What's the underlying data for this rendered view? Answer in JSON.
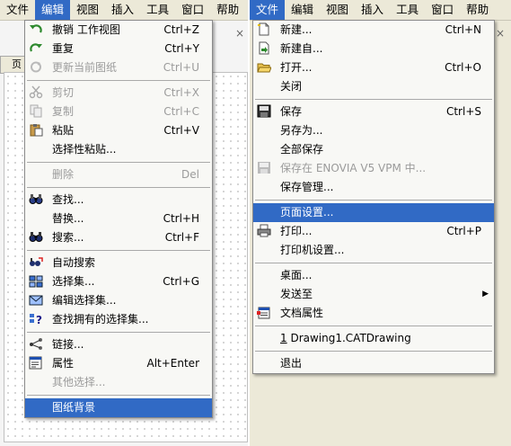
{
  "left_menubar": [
    "文件",
    "编辑",
    "视图",
    "插入",
    "工具",
    "窗口",
    "帮助"
  ],
  "right_menubar": [
    "文件",
    "编辑",
    "视图",
    "插入",
    "工具",
    "窗口",
    "帮助"
  ],
  "left_tab_label": "页",
  "close_glyph": "×",
  "edit_menu": [
    {
      "label": "撤销 工作视图",
      "shortcut": "Ctrl+Z",
      "icon": "undo-icon",
      "disabled": false
    },
    {
      "label": "重复",
      "shortcut": "Ctrl+Y",
      "icon": "redo-icon",
      "disabled": false
    },
    {
      "label": "更新当前图纸",
      "shortcut": "Ctrl+U",
      "icon": "update-icon",
      "disabled": true
    },
    {
      "sep": true
    },
    {
      "label": "剪切",
      "shortcut": "Ctrl+X",
      "icon": "cut-icon",
      "disabled": true
    },
    {
      "label": "复制",
      "shortcut": "Ctrl+C",
      "icon": "copy-icon",
      "disabled": true
    },
    {
      "label": "粘贴",
      "shortcut": "Ctrl+V",
      "icon": "paste-icon",
      "disabled": false
    },
    {
      "label": "选择性粘贴...",
      "shortcut": "",
      "icon": "",
      "disabled": false
    },
    {
      "sep": true
    },
    {
      "label": "删除",
      "shortcut": "Del",
      "icon": "",
      "disabled": true
    },
    {
      "sep": true
    },
    {
      "label": "查找...",
      "shortcut": "",
      "icon": "find-icon",
      "disabled": false
    },
    {
      "label": "替换...",
      "shortcut": "Ctrl+H",
      "icon": "",
      "disabled": false
    },
    {
      "label": "搜索...",
      "shortcut": "Ctrl+F",
      "icon": "search-icon",
      "disabled": false
    },
    {
      "sep": true
    },
    {
      "label": "自动搜索",
      "shortcut": "",
      "icon": "auto-search-icon",
      "disabled": false
    },
    {
      "label": "选择集...",
      "shortcut": "Ctrl+G",
      "icon": "selection-set-icon",
      "disabled": false
    },
    {
      "label": "编辑选择集...",
      "shortcut": "",
      "icon": "edit-selection-set-icon",
      "disabled": false
    },
    {
      "label": "查找拥有的选择集...",
      "shortcut": "",
      "icon": "find-owned-set-icon",
      "disabled": false
    },
    {
      "sep": true
    },
    {
      "label": "链接...",
      "shortcut": "",
      "icon": "links-icon",
      "disabled": false
    },
    {
      "label": "属性",
      "shortcut": "Alt+Enter",
      "icon": "properties-icon",
      "disabled": false
    },
    {
      "label": "其他选择...",
      "shortcut": "",
      "icon": "",
      "disabled": true
    },
    {
      "sep": true
    },
    {
      "label": "图纸背景",
      "shortcut": "",
      "icon": "",
      "disabled": false,
      "highlighted": true
    }
  ],
  "file_menu": [
    {
      "label": "新建...",
      "shortcut": "Ctrl+N",
      "icon": "new-file-icon",
      "disabled": false
    },
    {
      "label": "新建自...",
      "shortcut": "",
      "icon": "new-from-icon",
      "disabled": false
    },
    {
      "label": "打开...",
      "shortcut": "Ctrl+O",
      "icon": "open-folder-icon",
      "disabled": false
    },
    {
      "label": "关闭",
      "shortcut": "",
      "icon": "",
      "disabled": false
    },
    {
      "sep": true
    },
    {
      "label": "保存",
      "shortcut": "Ctrl+S",
      "icon": "save-icon",
      "disabled": false
    },
    {
      "label": "另存为...",
      "shortcut": "",
      "icon": "",
      "disabled": false
    },
    {
      "label": "全部保存",
      "shortcut": "",
      "icon": "",
      "disabled": false
    },
    {
      "label": "保存在 ENOVIA V5 VPM 中...",
      "shortcut": "",
      "icon": "enovia-save-icon",
      "disabled": true
    },
    {
      "label": "保存管理...",
      "shortcut": "",
      "icon": "",
      "disabled": false
    },
    {
      "sep": true
    },
    {
      "label": "页面设置...",
      "shortcut": "",
      "icon": "",
      "disabled": false,
      "highlighted": true
    },
    {
      "label": "打印...",
      "shortcut": "Ctrl+P",
      "icon": "print-icon",
      "disabled": false
    },
    {
      "label": "打印机设置...",
      "shortcut": "",
      "icon": "",
      "disabled": false
    },
    {
      "sep": true
    },
    {
      "label": "桌面...",
      "shortcut": "",
      "icon": "",
      "disabled": false
    },
    {
      "label": "发送至",
      "shortcut": "",
      "icon": "",
      "disabled": false,
      "submenu": true
    },
    {
      "label": "文档属性",
      "shortcut": "",
      "icon": "document-properties-icon",
      "disabled": false
    },
    {
      "sep": true
    },
    {
      "label": "1 Drawing1.CATDrawing",
      "shortcut": "",
      "icon": "",
      "disabled": false,
      "recent": true
    },
    {
      "sep": true
    },
    {
      "label": "退出",
      "shortcut": "",
      "icon": "",
      "disabled": false
    }
  ]
}
